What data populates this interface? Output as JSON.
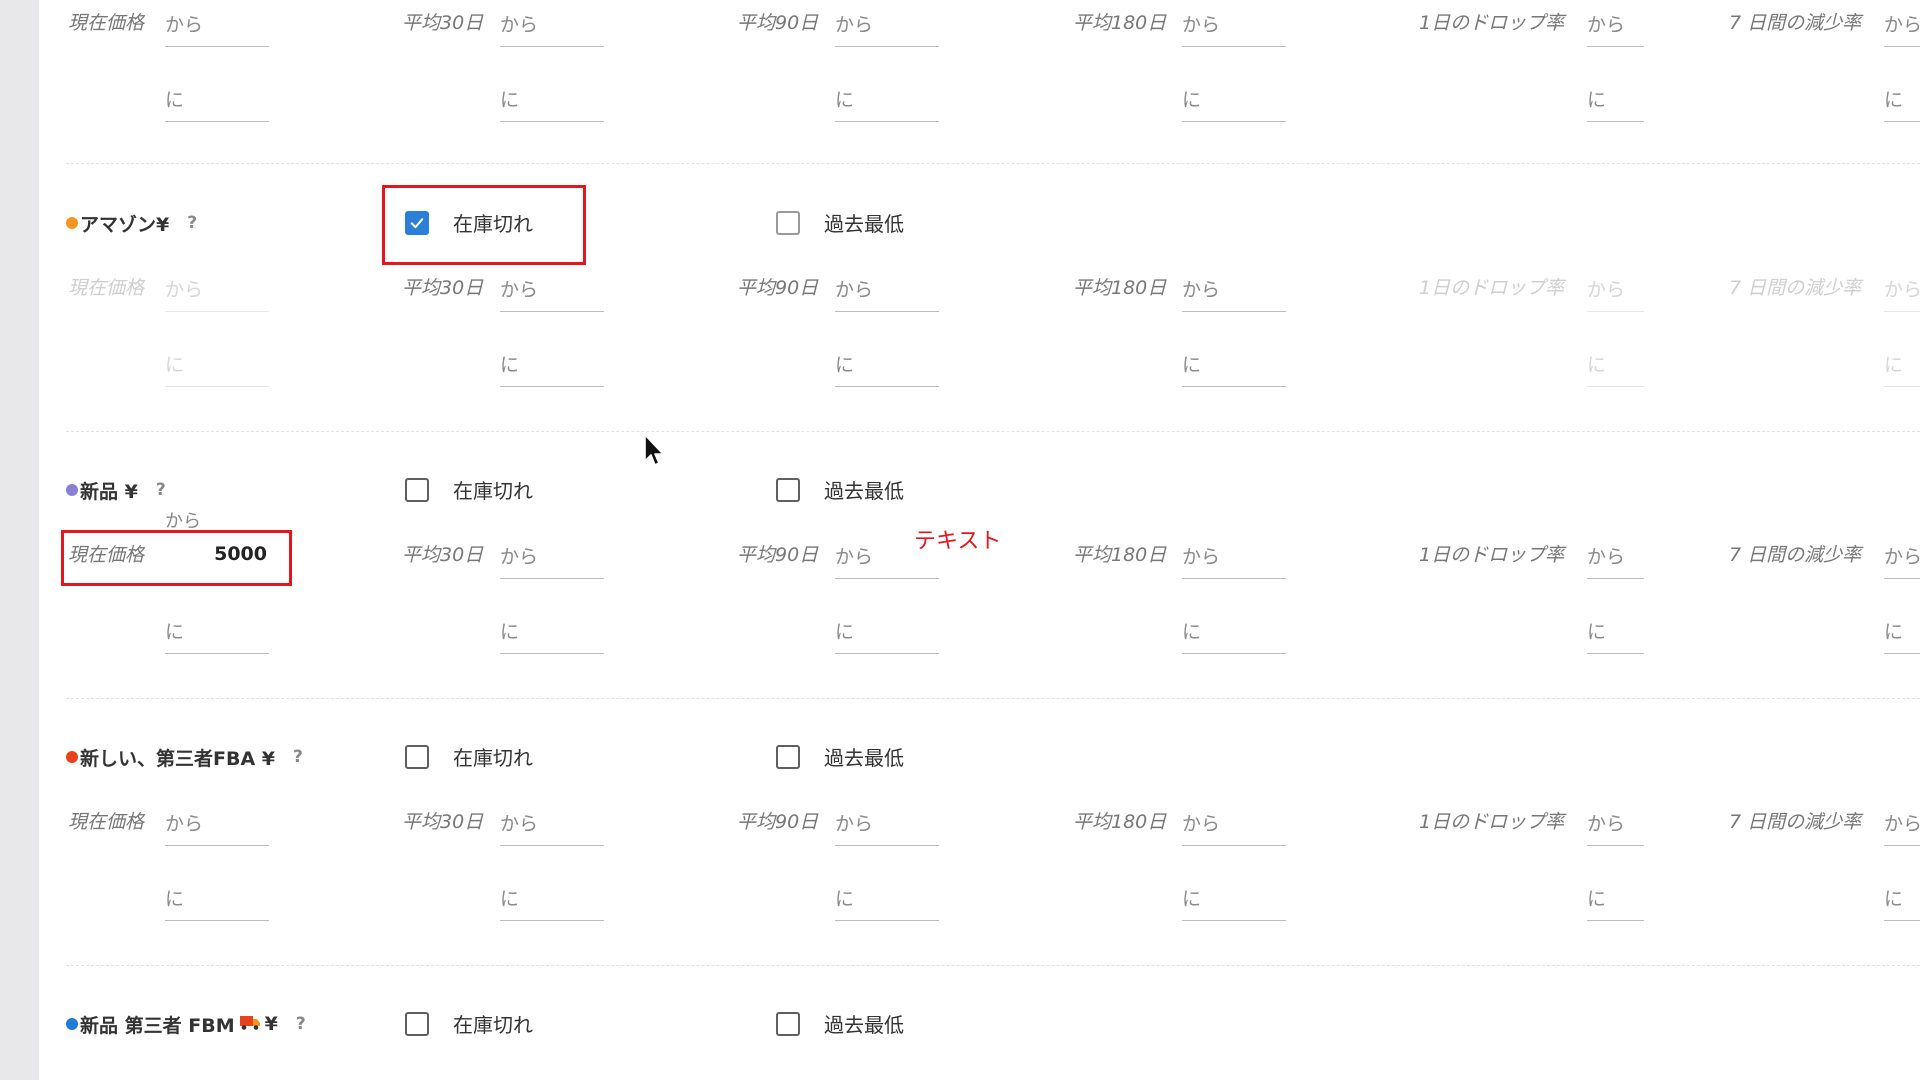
{
  "labels": {
    "from": "から",
    "to": "に",
    "out_of_stock": "在庫切れ",
    "all_time_low": "過去最低",
    "help": "?",
    "currency_suffix": "¥"
  },
  "fields": [
    "現在価格",
    "平均30日",
    "平均90日",
    "平均180日",
    "1日のドロップ率",
    "7 日間の減少率"
  ],
  "sections": [
    {
      "title": "アマゾン¥",
      "dot_color": "#f7931e",
      "out_of_stock_checked": true,
      "all_time_low_checked": false
    },
    {
      "title": "新品 ¥",
      "dot_color": "#8a7fd6",
      "out_of_stock_checked": false,
      "all_time_low_checked": false,
      "current_price_from_value": "5000"
    },
    {
      "title": "新しい、第三者FBA ¥",
      "dot_color": "#e8411c",
      "out_of_stock_checked": false,
      "all_time_low_checked": false
    },
    {
      "title_prefix": "新品 第三者 FBM",
      "title_suffix": "¥",
      "dot_color": "#1f7bd8",
      "icon": "truck-icon",
      "out_of_stock_checked": false,
      "all_time_low_checked": false
    }
  ],
  "annotation": "テキスト",
  "colors": {
    "accent_checkbox": "#2c7fd9",
    "highlight_red": "#e5161c"
  }
}
